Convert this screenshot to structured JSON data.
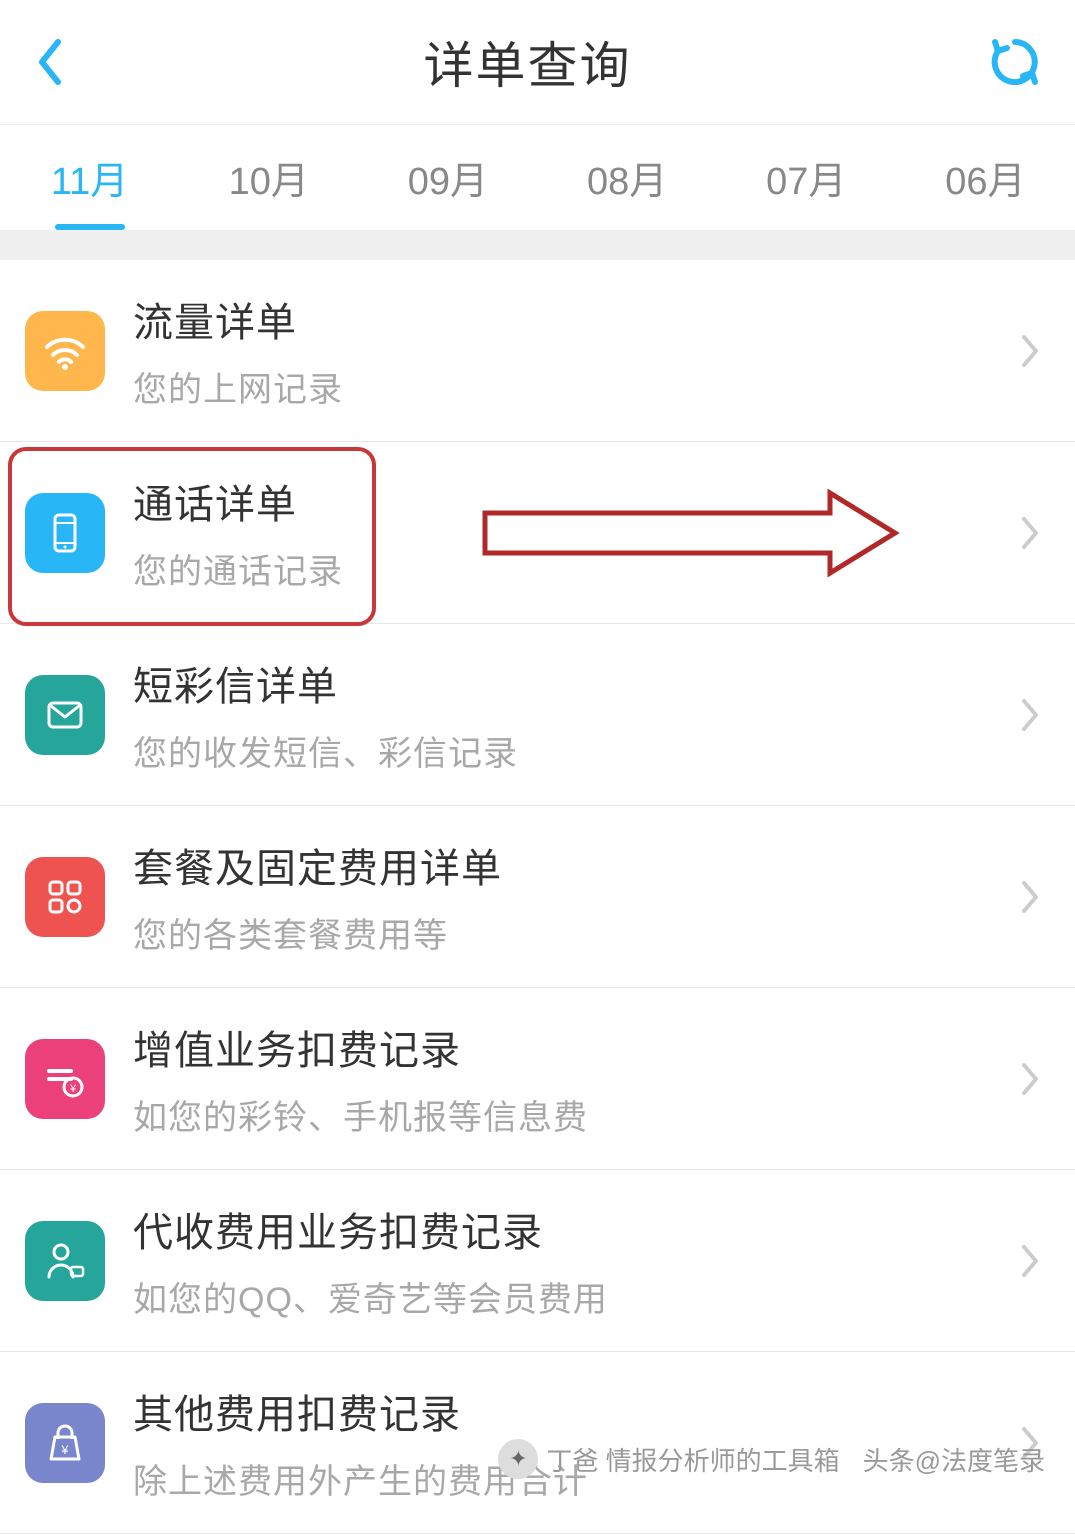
{
  "header": {
    "title": "详单查询"
  },
  "tabs": [
    {
      "label": "11月",
      "active": true
    },
    {
      "label": "10月",
      "active": false
    },
    {
      "label": "09月",
      "active": false
    },
    {
      "label": "08月",
      "active": false
    },
    {
      "label": "07月",
      "active": false
    },
    {
      "label": "06月",
      "active": false
    }
  ],
  "items": [
    {
      "title": "流量详单",
      "subtitle": "您的上网记录",
      "icon": "wifi",
      "color": "#ffb74d"
    },
    {
      "title": "通话详单",
      "subtitle": "您的通话记录",
      "icon": "phone",
      "color": "#29b6f6",
      "highlighted": true
    },
    {
      "title": "短彩信详单",
      "subtitle": "您的收发短信、彩信记录",
      "icon": "mail",
      "color": "#26a69a"
    },
    {
      "title": "套餐及固定费用详单",
      "subtitle": "您的各类套餐费用等",
      "icon": "grid",
      "color": "#ef5350"
    },
    {
      "title": "增值业务扣费记录",
      "subtitle": "如您的彩铃、手机报等信息费",
      "icon": "card",
      "color": "#ec407a"
    },
    {
      "title": "代收费用业务扣费记录",
      "subtitle": "如您的QQ、爱奇艺等会员费用",
      "icon": "user",
      "color": "#26a69a"
    },
    {
      "title": "其他费用扣费记录",
      "subtitle": "除上述费用外产生的费用合计",
      "icon": "bag",
      "color": "#7986cb"
    }
  ],
  "watermark": {
    "text1": "丁爸 情报分析师的工具箱",
    "text2": "头条@法度笔录"
  }
}
